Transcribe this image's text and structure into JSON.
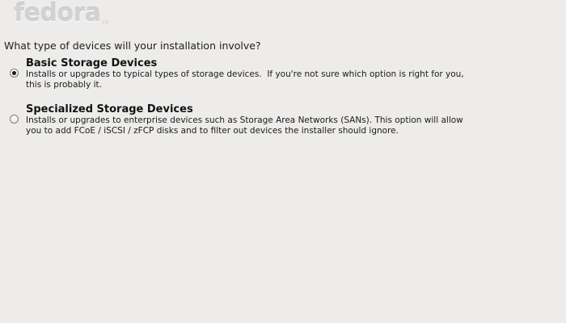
{
  "logo": {
    "text": "fedora",
    "trademark": "TM"
  },
  "question": "What type of devices will your installation involve?",
  "options": [
    {
      "title": "Basic Storage Devices",
      "description": "Installs or upgrades to typical types of storage devices.  If you're not sure which option is right for you,\nthis is probably it.",
      "selected": true
    },
    {
      "title": "Specialized Storage Devices",
      "description": "Installs or upgrades to enterprise devices such as Storage Area Networks (SANs). This option will allow\nyou to add FCoE / iSCSI / zFCP disks and to filter out devices the installer should ignore.",
      "selected": false
    }
  ]
}
